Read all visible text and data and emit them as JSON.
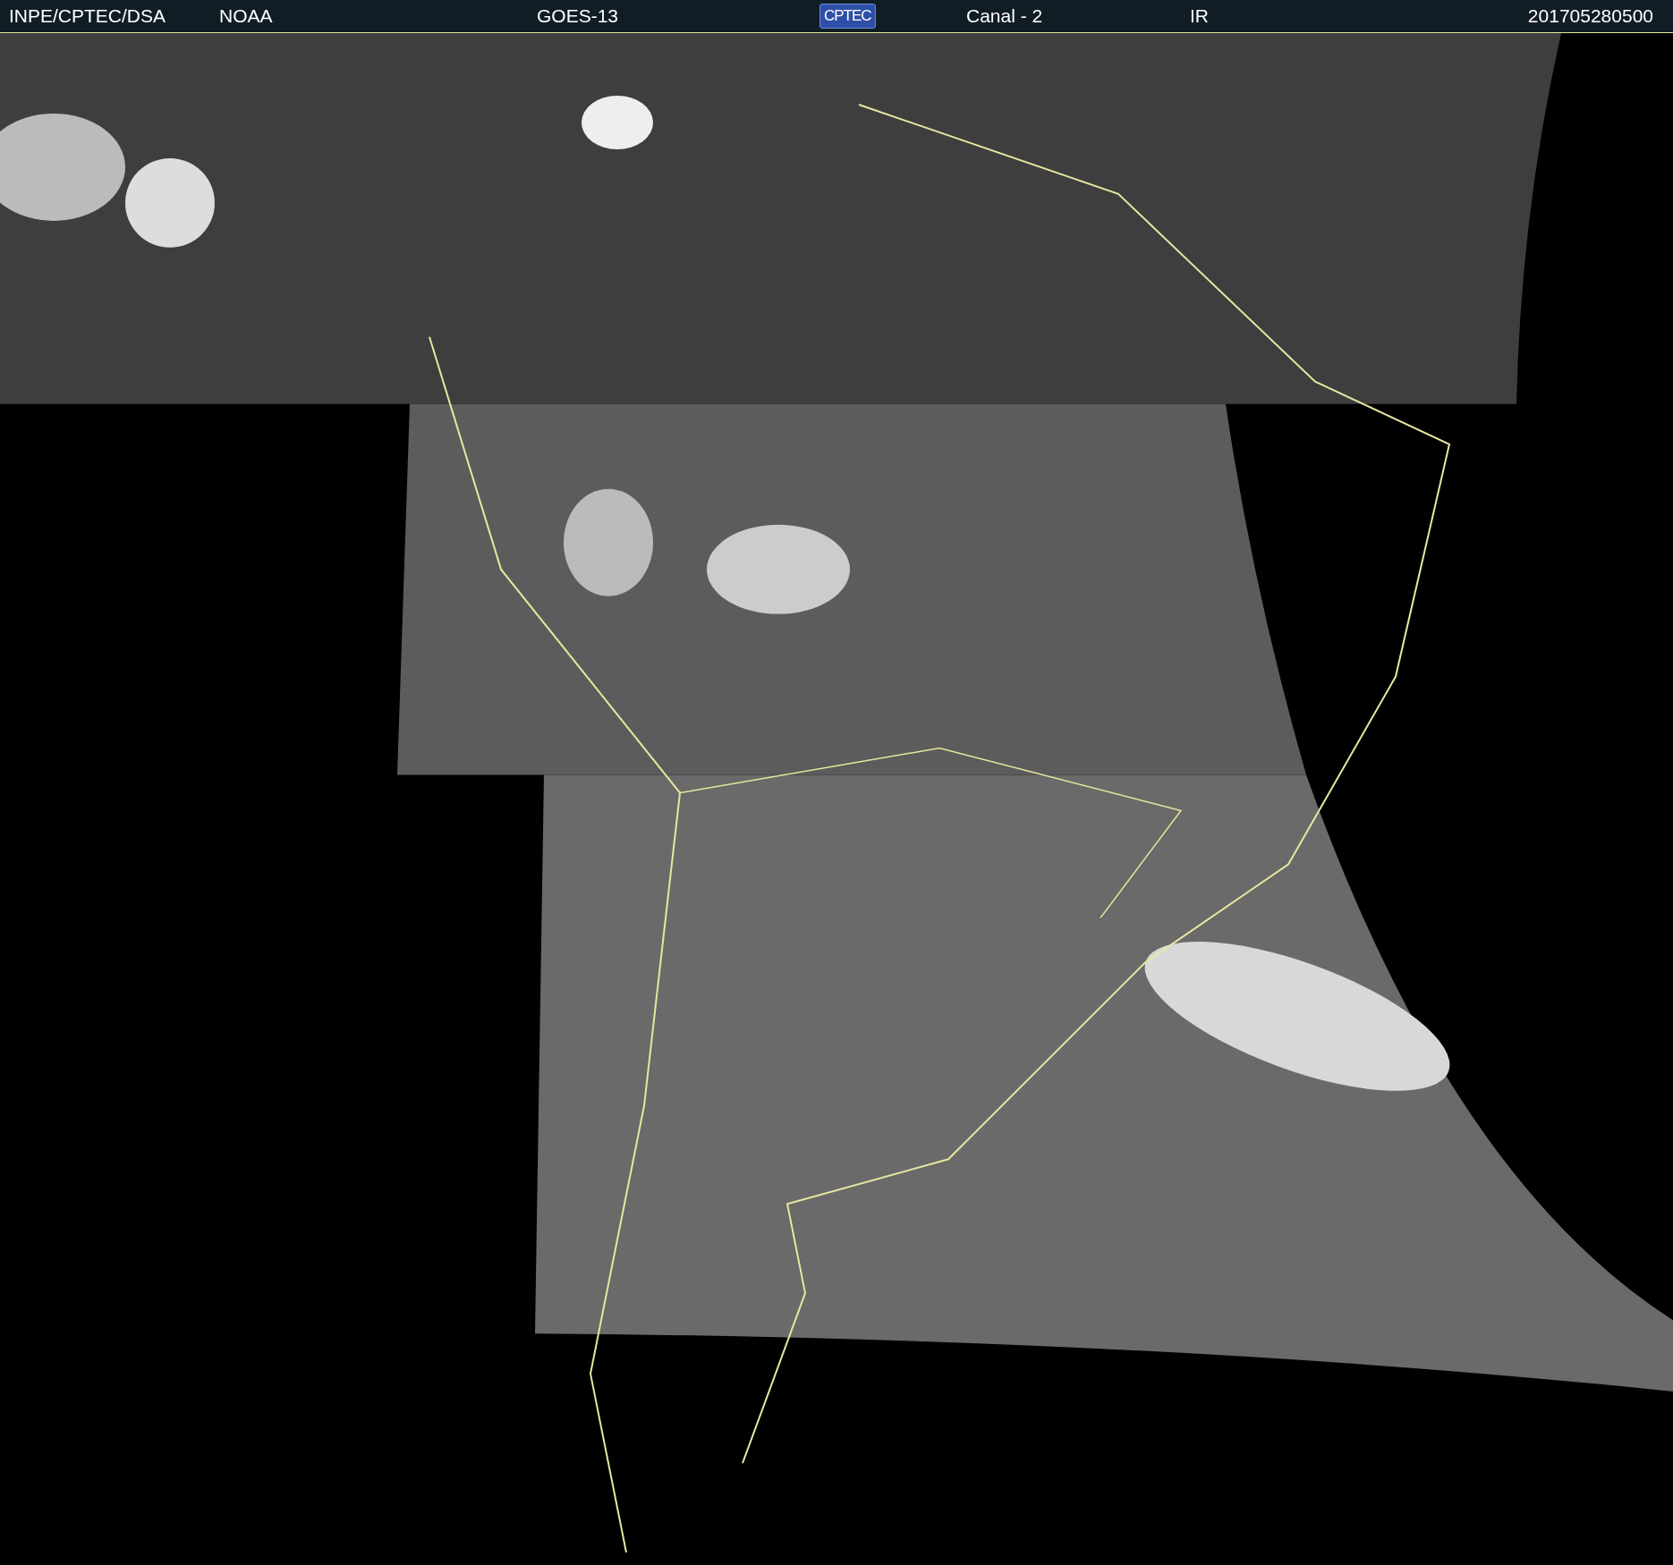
{
  "header": {
    "items": [
      {
        "kind": "text",
        "text": "INPE/CPTEC/DSA"
      },
      {
        "kind": "text",
        "text": "NOAA"
      },
      {
        "kind": "text",
        "text": "GOES-13"
      },
      {
        "kind": "logo",
        "text": "CPTEC"
      },
      {
        "kind": "text",
        "text": "Canal - 2"
      },
      {
        "kind": "text",
        "text": "IR"
      },
      {
        "kind": "text",
        "text": "201705280500"
      }
    ]
  }
}
